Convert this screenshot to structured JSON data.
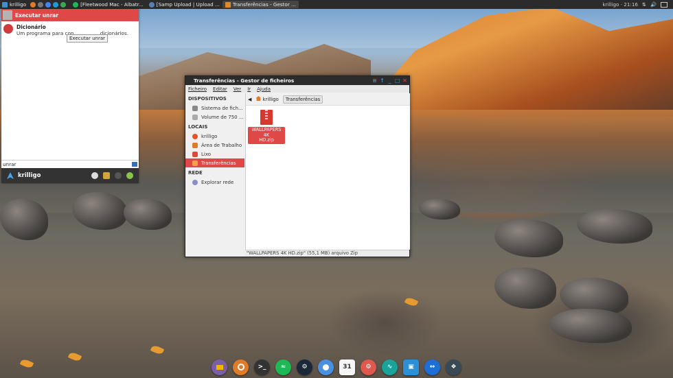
{
  "topbar": {
    "user": "krilligo",
    "tasks": [
      {
        "label": "[Fleetwood Mac - Albatr...",
        "color": "#1db954",
        "active": false
      },
      {
        "label": "[Samp Upload | Upload ...",
        "color": "#5a7fb4",
        "active": false
      },
      {
        "label": "Transferências - Gestor ...",
        "color": "#e08b2a",
        "active": true
      }
    ],
    "clock": "krilligo · 21:16"
  },
  "launcher": {
    "header": "Executar unrar",
    "result_title": "Dicionário",
    "result_desc": "Um programa para con",
    "result_desc_end": "dicionários.",
    "tooltip": "Executar unrar",
    "input_value": "unrar",
    "user": "krilligo"
  },
  "file_manager": {
    "title": "Transferências - Gestor de ficheiros",
    "menu": [
      "Ficheiro",
      "Editar",
      "Ver",
      "Ir",
      "Ajuda"
    ],
    "sections": {
      "devices_header": "DISPOSITIVOS",
      "devices": [
        "Sistema de fich...",
        "Volume de 750 ..."
      ],
      "places_header": "LOCAIS",
      "places": [
        "krilligo",
        "Área de Trabalho",
        "Lixo",
        "Transferências"
      ],
      "network_header": "REDE",
      "network": [
        "Explorar rede"
      ]
    },
    "breadcrumb": [
      "krilligo",
      "Transferências"
    ],
    "file_label_line1": "WALLPAPERS 4K",
    "file_label_line2": "HD.zip",
    "status": "\"WALLPAPERS 4K HD.zip\" (55,1 MB) arquivo Zip"
  },
  "dock": {
    "calendar_day": "31",
    "icons": [
      "files-icon",
      "ubuntu-icon",
      "terminal-icon",
      "spotify-icon",
      "steam-icon",
      "chromium-icon",
      "calendar-icon",
      "settings-icon",
      "system-monitor-icon",
      "image-viewer-icon",
      "teamviewer-icon",
      "kodi-icon"
    ]
  }
}
